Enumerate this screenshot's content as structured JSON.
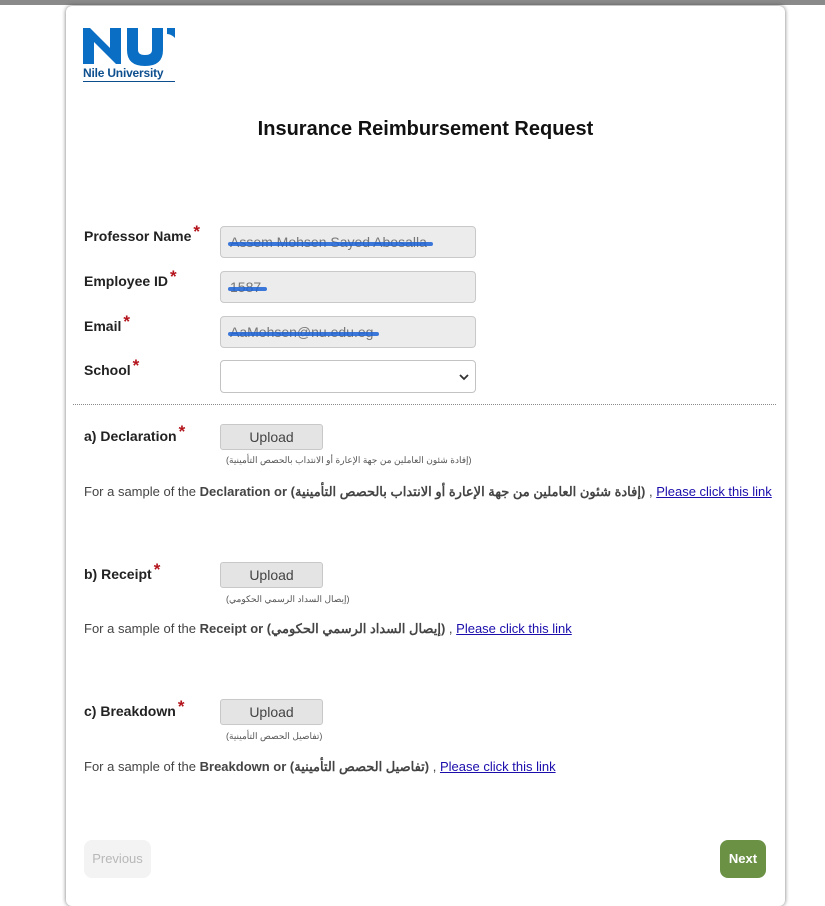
{
  "brand": {
    "logo_text": "Nile University",
    "logo_color": "#0a6fc4"
  },
  "title": "Insurance Reimbursement Request",
  "fields": {
    "professor_name": {
      "label": "Professor Name",
      "value": "Assem Mohsen Sayed Abosalla"
    },
    "employee_id": {
      "label": "Employee ID",
      "value": "1587"
    },
    "email": {
      "label": "Email",
      "value": "AaMohsen@nu.edu.eg"
    },
    "school": {
      "label": "School",
      "value": ""
    }
  },
  "required_marker": "*",
  "sections": [
    {
      "label": "a) Declaration",
      "upload_label": "Upload",
      "hint": "(إفادة شئون العاملين من جهة الإعارة أو الانتداب بالحصص التأمينية)",
      "sample_prefix": "For a sample of the",
      "sample_bold": "Declaration or (إفادة شئون العاملين من جهة الإعارة أو الانتداب بالحصص التأمينية)",
      "sample_sep": ",",
      "link": "Please click this link"
    },
    {
      "label": "b) Receipt",
      "upload_label": "Upload",
      "hint": "(إيصال السداد الرسمي الحكومي)",
      "sample_prefix": "For a sample of the",
      "sample_bold": "Receipt or (إيصال السداد الرسمي الحكومي)",
      "sample_sep": ",",
      "link": "Please click this link"
    },
    {
      "label": "c) Breakdown",
      "upload_label": "Upload",
      "hint": "(تفاصيل الحصص التأمينية)",
      "sample_prefix": "For a sample of the",
      "sample_bold": "Breakdown or (تفاصيل الحصص التأمينية)",
      "sample_sep": ",",
      "link": "Please click this link"
    }
  ],
  "nav": {
    "previous": "Previous",
    "next": "Next",
    "next_color": "#6b9145"
  }
}
